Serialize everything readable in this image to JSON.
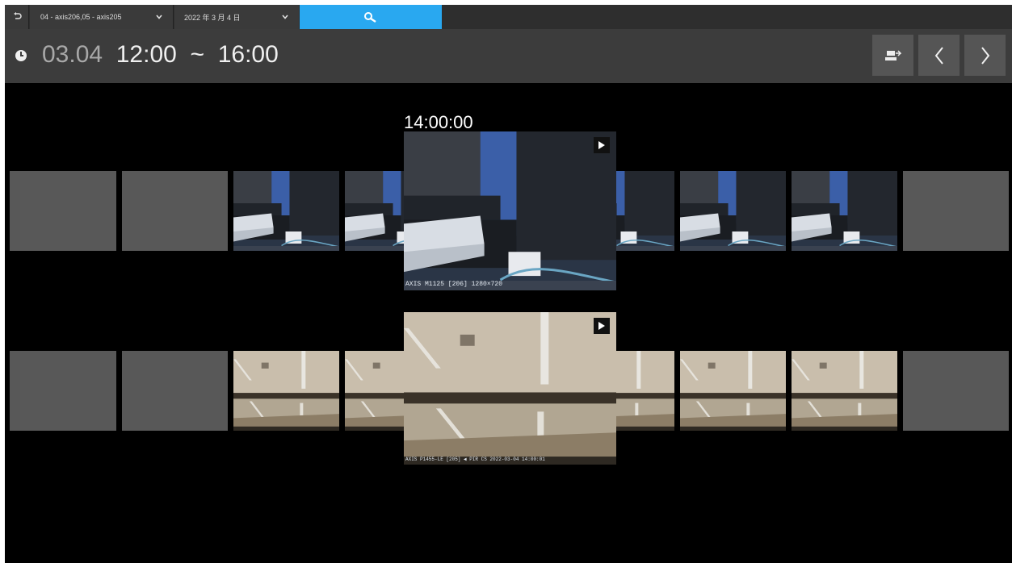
{
  "toolbar": {
    "camera_selector": "04 - axis206,05 - axis205",
    "date_selector": "2022 年 3 月 4 日"
  },
  "timebar": {
    "date": "03.04",
    "start": "12:00",
    "separator": "~",
    "end": "16:00"
  },
  "preview": {
    "time": "14:00:00",
    "camera1_overlay": "AXIS M1125 [206] 1280×720",
    "camera2_overlay": "AXIS P1455-LE [205] ◀ PIR CS 2022-03-04 14:00:01"
  },
  "colors": {
    "accent": "#29a8f0",
    "toolbar_bg": "#2e2e2e",
    "timebar_bg": "#3c3c3c",
    "empty_thumb": "#585858"
  }
}
